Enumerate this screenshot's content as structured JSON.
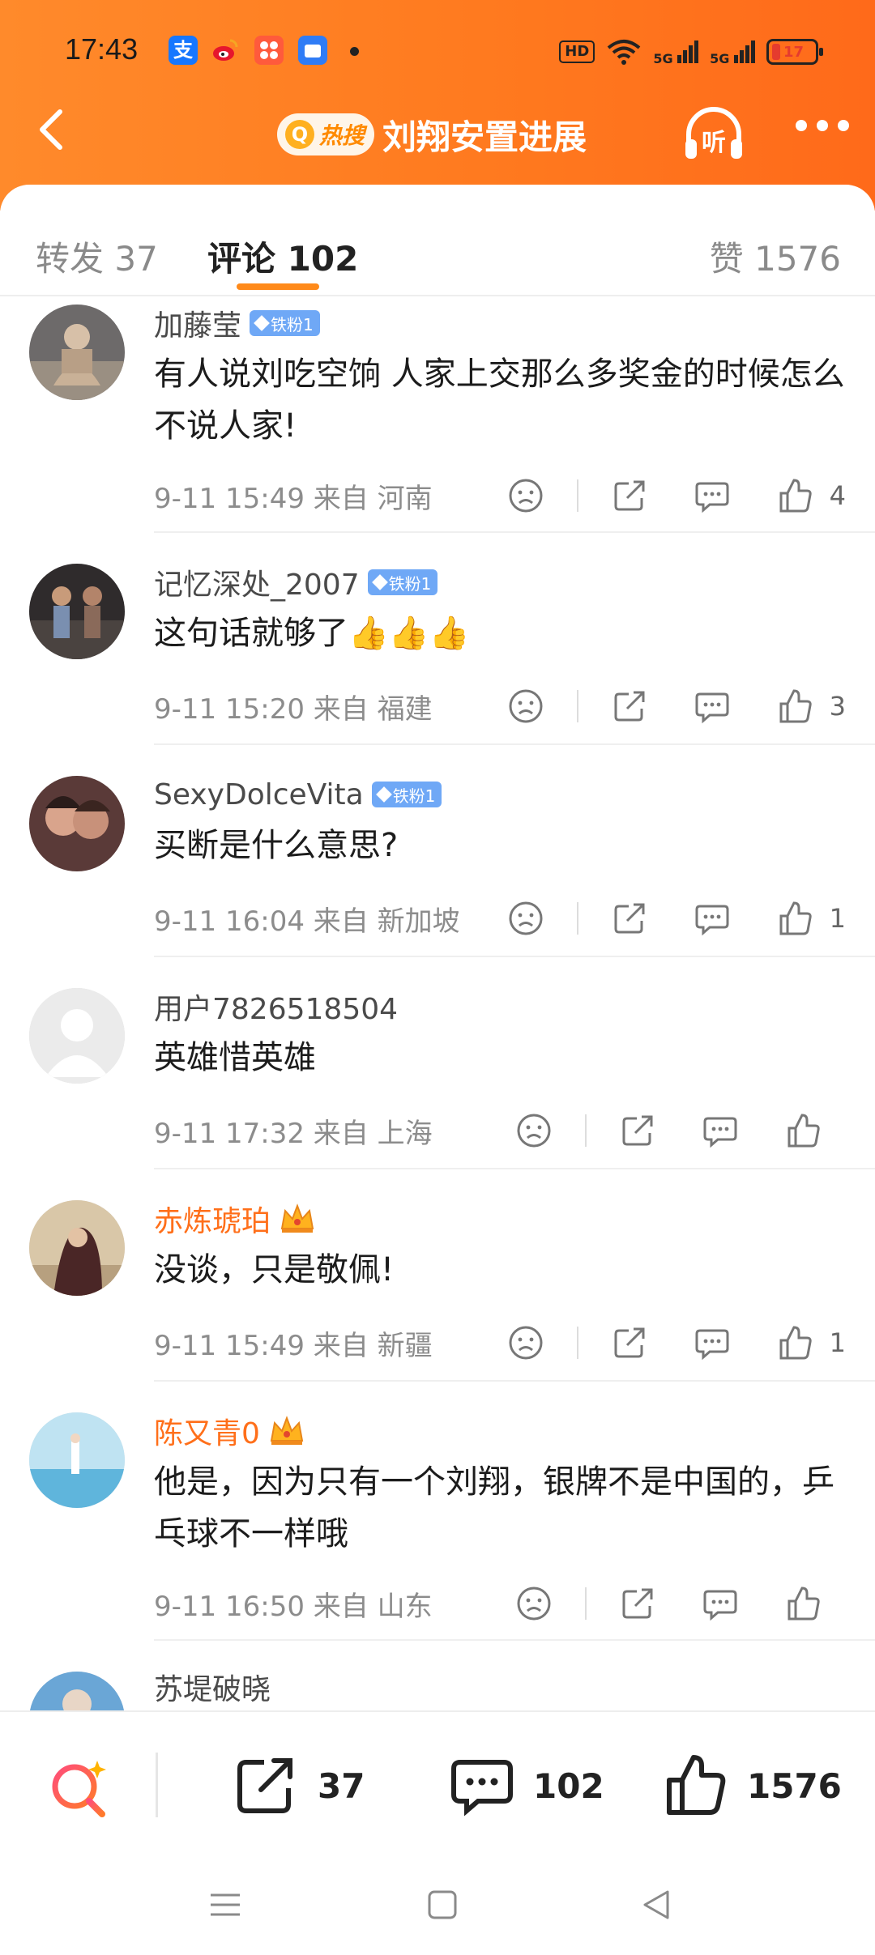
{
  "status": {
    "time": "17:43",
    "app_icons": [
      "alipay-icon",
      "weibo-icon",
      "app-grid-icon",
      "files-icon"
    ],
    "hd": "HD",
    "sig1": "5G",
    "sig2": "5G",
    "battery": "17"
  },
  "nav": {
    "hot_label": "热搜",
    "title": "刘翔安置进展",
    "listen_label": "听"
  },
  "tabs": {
    "repost": "转发 37",
    "comment": "评论 102",
    "like": "赞 1576"
  },
  "comments": [
    {
      "user": "加藤莹",
      "badge": "铁粉1",
      "text": "有人说刘吃空饷  人家上交那么多奖金的时候怎么不说人家!",
      "when": "9-11 15:49  来自 河南",
      "likes": "4"
    },
    {
      "user": "记忆深处_2007",
      "badge": "铁粉1",
      "text": "这句话就够了👍👍👍",
      "when": "9-11 15:20  来自 福建",
      "likes": "3"
    },
    {
      "user": "SexyDolceVita",
      "badge": "铁粉1",
      "text": "买断是什么意思?",
      "when": "9-11 16:04  来自 新加坡",
      "likes": "1"
    },
    {
      "user": "用户7826518504",
      "badge": "",
      "text": "英雄惜英雄",
      "when": "9-11 17:32  来自 上海",
      "likes": ""
    },
    {
      "user": "赤炼琥珀",
      "badge": "",
      "text": "没谈，只是敬佩!",
      "when": "9-11 15:49  来自 新疆",
      "likes": "1"
    },
    {
      "user": "陈又青0",
      "badge": "",
      "text": "他是，因为只有一个刘翔，银牌不是中国的，乒乓球不一样哦",
      "when": "9-11 16:50  来自 山东",
      "likes": ""
    },
    {
      "user": "苏堤破晓"
    }
  ],
  "bottom": {
    "repost_count": "37",
    "comment_count": "102",
    "like_count": "1576"
  },
  "colors": {
    "accent": "#ff7a1f",
    "vip_name": "#ff6f1a",
    "fan_badge": "#6fa8f6"
  }
}
